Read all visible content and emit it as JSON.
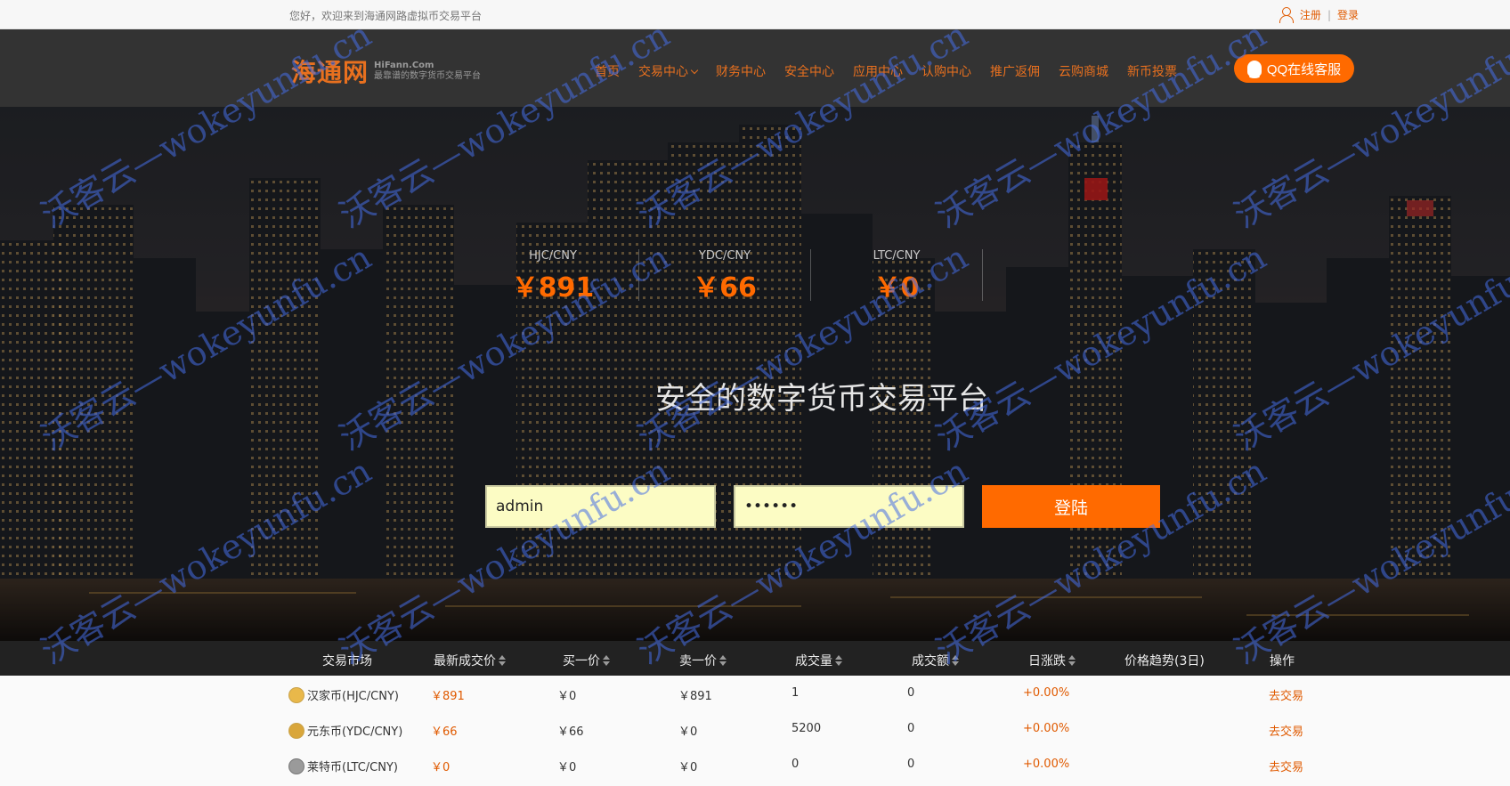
{
  "topbar": {
    "welcome": "您好，欢迎来到海通网路虚拟币交易平台",
    "register": "注册",
    "separator": "|",
    "login": "登录"
  },
  "header": {
    "logo_main": "海通网",
    "logo_en": "HiFann.Com",
    "logo_cn": "最靠谱的数字货币交易平台",
    "nav": [
      "首页",
      "交易中心",
      "财务中心",
      "安全中心",
      "应用中心",
      "认购中心",
      "推广返佣",
      "云购商城",
      "新币投票"
    ],
    "qq_button": "QQ在线客服"
  },
  "colors": {
    "accent": "#ff6a00",
    "header_bg": "#333333",
    "table_head_bg": "#222222"
  },
  "hero": {
    "tickers": [
      {
        "pair": "HJC/CNY",
        "price": "￥891"
      },
      {
        "pair": "YDC/CNY",
        "price": "￥66"
      },
      {
        "pair": "LTC/CNY",
        "price": "￥0"
      }
    ],
    "slogan": "安全的数字货币交易平台",
    "username_value": "admin",
    "password_value": "••••••",
    "login_button": "登陆"
  },
  "table": {
    "headers": [
      "交易市场",
      "最新成交价",
      "买一价",
      "卖一价",
      "成交量",
      "成交额",
      "日涨跌",
      "价格趋势(3日)",
      "操作"
    ],
    "rows": [
      {
        "market": "汉家币(HJC/CNY)",
        "coin_icon": "hjc-coin-icon",
        "last": "￥891",
        "bid": "￥0",
        "ask": "￥891",
        "volume": "1",
        "amount": "0",
        "change": "+0.00%",
        "action": "去交易"
      },
      {
        "market": "元东币(YDC/CNY)",
        "coin_icon": "ydc-coin-icon",
        "last": "￥66",
        "bid": "￥66",
        "ask": "￥0",
        "volume": "5200",
        "amount": "0",
        "change": "+0.00%",
        "action": "去交易"
      },
      {
        "market": "莱特币(LTC/CNY)",
        "coin_icon": "ltc-coin-icon",
        "last": "￥0",
        "bid": "￥0",
        "ask": "￥0",
        "volume": "0",
        "amount": "0",
        "change": "+0.00%",
        "action": "去交易"
      }
    ]
  },
  "watermark": "沃客云—wokeyunfu.cn"
}
